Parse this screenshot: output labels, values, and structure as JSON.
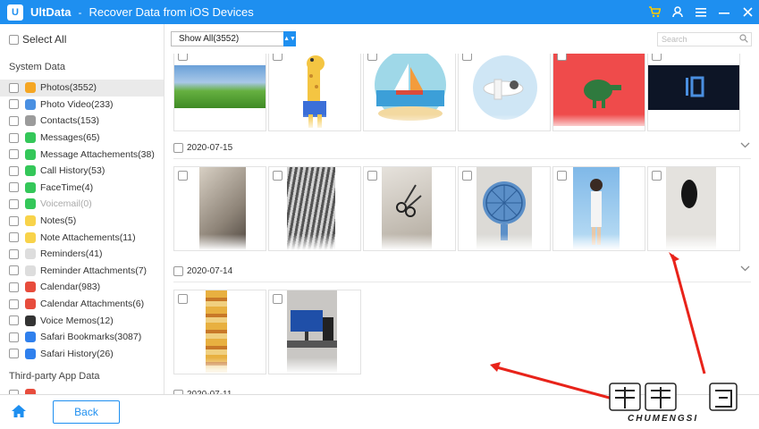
{
  "titlebar": {
    "app_name": "UltData",
    "separator": "-",
    "window_title": "Recover Data from iOS Devices",
    "icons": [
      "cart-icon",
      "user-icon",
      "menu-icon",
      "minimize-icon",
      "close-icon"
    ]
  },
  "sidebar": {
    "select_all": "Select All",
    "system_label": "System Data",
    "items": [
      {
        "label": "Photos(3552)",
        "icon": "photos-icon",
        "color": "#f5a623"
      },
      {
        "label": "Photo Video(233)",
        "icon": "video-icon",
        "color": "#4a90e2"
      },
      {
        "label": "Contacts(153)",
        "icon": "contacts-icon",
        "color": "#9b9b9b"
      },
      {
        "label": "Messages(65)",
        "icon": "messages-icon",
        "color": "#34c759"
      },
      {
        "label": "Message Attachements(38)",
        "icon": "message-attachments-icon",
        "color": "#34c759"
      },
      {
        "label": "Call History(53)",
        "icon": "phone-icon",
        "color": "#34c759"
      },
      {
        "label": "FaceTime(4)",
        "icon": "facetime-icon",
        "color": "#34c759"
      },
      {
        "label": "Voicemail(0)",
        "icon": "voicemail-icon",
        "color": "#34c759"
      },
      {
        "label": "Notes(5)",
        "icon": "notes-icon",
        "color": "#f8d34a"
      },
      {
        "label": "Note Attachements(11)",
        "icon": "note-attachments-icon",
        "color": "#f8d34a"
      },
      {
        "label": "Reminders(41)",
        "icon": "reminders-icon",
        "color": "#dddddd"
      },
      {
        "label": "Reminder Attachments(7)",
        "icon": "reminder-attachments-icon",
        "color": "#dddddd"
      },
      {
        "label": "Calendar(983)",
        "icon": "calendar-icon",
        "color": "#e74c3c"
      },
      {
        "label": "Calendar Attachments(6)",
        "icon": "calendar-attachments-icon",
        "color": "#e74c3c"
      },
      {
        "label": "Voice Memos(12)",
        "icon": "voice-memos-icon",
        "color": "#333333"
      },
      {
        "label": "Safari Bookmarks(3087)",
        "icon": "safari-icon",
        "color": "#2f80ed"
      },
      {
        "label": "Safari History(26)",
        "icon": "safari-history-icon",
        "color": "#2f80ed"
      }
    ],
    "third_party_label": "Third-party App Data"
  },
  "toolbar": {
    "filter_value": "Show All(3552)",
    "search_placeholder": "Search"
  },
  "groups": [
    {
      "date": ""
    },
    {
      "date": "2020-07-15"
    },
    {
      "date": "2020-07-14"
    },
    {
      "date": "2020-07-11"
    }
  ],
  "bottombar": {
    "back_label": "Back"
  },
  "watermark": {
    "text": "CHUMENGSI"
  },
  "colors": {
    "accent": "#1e8ff0",
    "annotation": "#e8231a"
  }
}
